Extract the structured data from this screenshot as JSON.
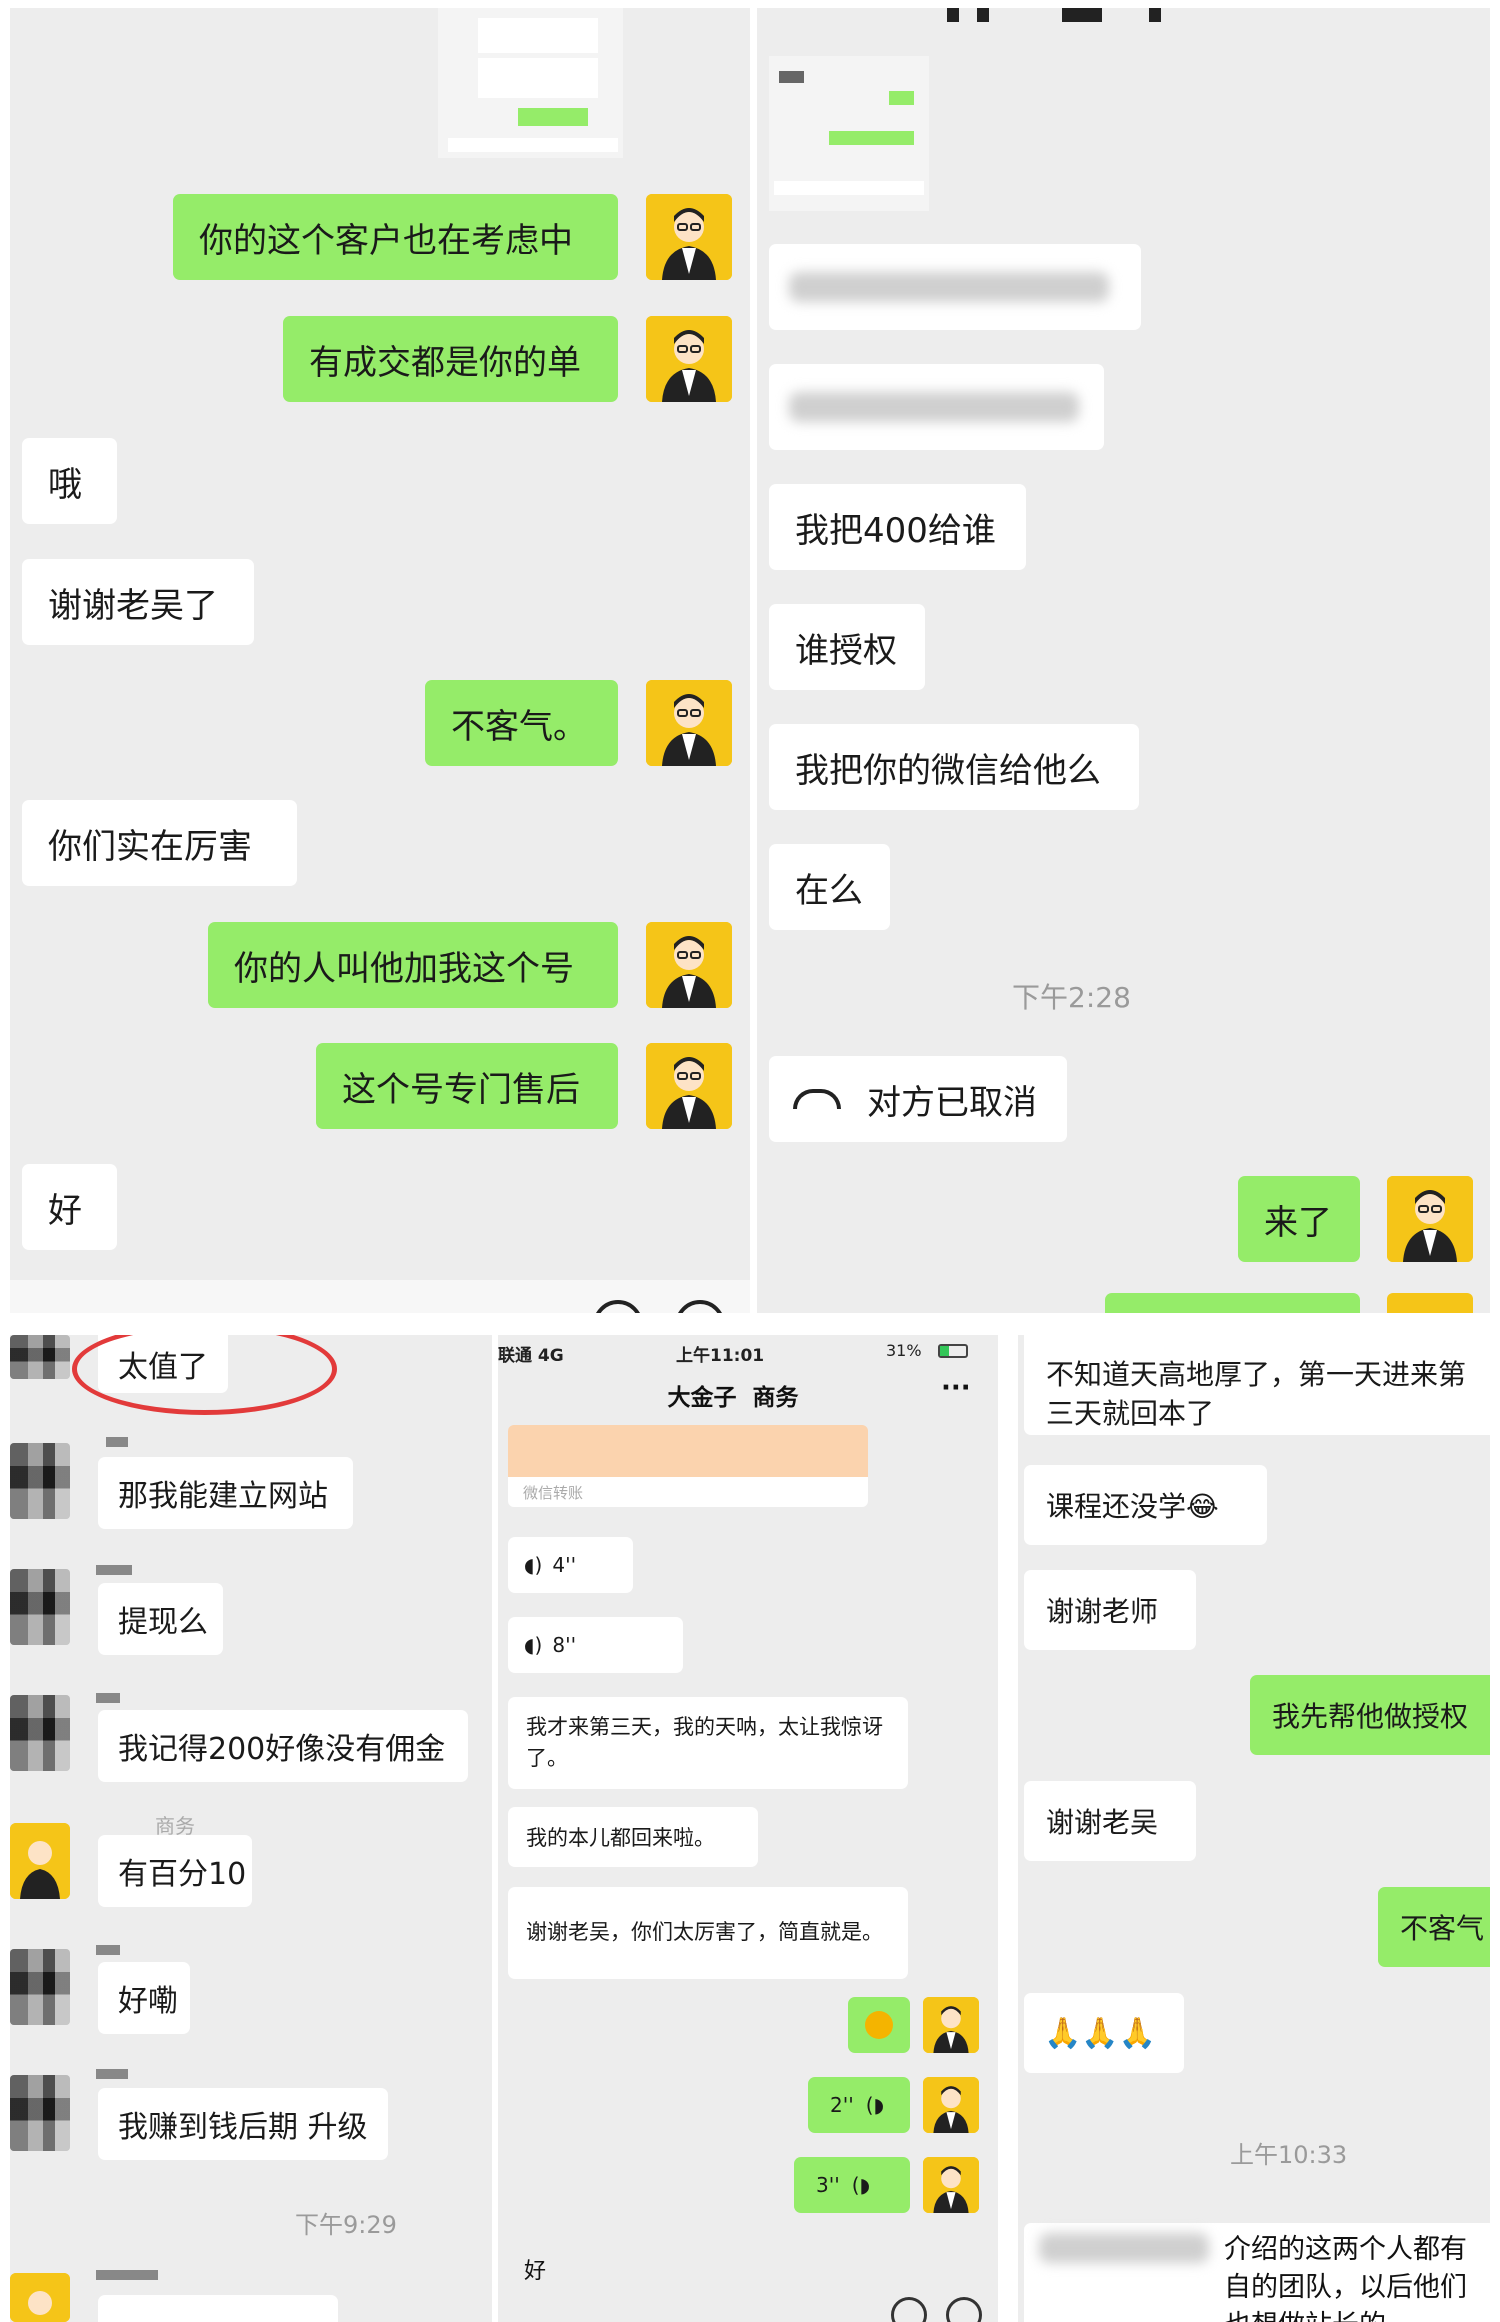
{
  "panel_tl": {
    "messages": [
      {
        "side": "out",
        "text": "你的这个客户也在考虑中"
      },
      {
        "side": "out",
        "text": "有成交都是你的单"
      },
      {
        "side": "in",
        "text": "哦"
      },
      {
        "side": "in",
        "text": "谢谢老吴了"
      },
      {
        "side": "out",
        "text": "不客气。"
      },
      {
        "side": "in",
        "text": "你们实在厉害"
      },
      {
        "side": "out",
        "text": "你的人叫他加我这个号"
      },
      {
        "side": "out",
        "text": "这个号专门售后"
      },
      {
        "side": "in",
        "text": "好"
      }
    ]
  },
  "panel_tr": {
    "messages": [
      {
        "side": "in",
        "text": "我把400给谁"
      },
      {
        "side": "in",
        "text": "谁授权"
      },
      {
        "side": "in",
        "text": "我把你的微信给他么"
      },
      {
        "side": "in",
        "text": "在么"
      }
    ],
    "timestamp": "下午2:28",
    "call_status": "对方已取消",
    "reply": "来了"
  },
  "panel_bl": {
    "messages": [
      {
        "text": "太值了"
      },
      {
        "text": "那我能建立网站"
      },
      {
        "text": "提现么"
      },
      {
        "text": "我记得200好像没有佣金"
      },
      {
        "text": "有百分10",
        "sender_tag": "商务"
      },
      {
        "text": "好嘞"
      },
      {
        "text": "我赚到钱后期 升级"
      }
    ],
    "timestamp": "下午9:29"
  },
  "panel_bm": {
    "status": {
      "carrier": "联通 4G",
      "time": "上午11:01",
      "battery": "31%"
    },
    "title": "大金子  商务",
    "more": "···",
    "transfer_label": "微信转账",
    "voice_in": [
      {
        "duration": "4''"
      },
      {
        "duration": "8''"
      }
    ],
    "messages": [
      {
        "text": "我才来第三天，我的天呐，太让我惊讶了。"
      },
      {
        "text": "我的本儿都回来啦。"
      },
      {
        "text": "谢谢老吴，你们太厉害了，简直就是。"
      }
    ],
    "voice_out": [
      {
        "duration": "2''"
      },
      {
        "duration": "3''"
      }
    ],
    "last": "好"
  },
  "panel_br": {
    "messages": [
      {
        "side": "in",
        "text": "不知道天高地厚了，第一天进来第三天就回本了"
      },
      {
        "side": "in",
        "text": "课程还没学😂"
      },
      {
        "side": "in",
        "text": "谢谢老师"
      },
      {
        "side": "out",
        "text": "我先帮他做授权"
      },
      {
        "side": "in",
        "text": "谢谢老吴"
      },
      {
        "side": "out",
        "text": "不客气"
      }
    ],
    "emoji_row": "🙏🙏🙏",
    "timestamp": "上午10:33",
    "bottom_text": "介绍的这两个人都有自的团队，以后他们也想做站长的"
  }
}
